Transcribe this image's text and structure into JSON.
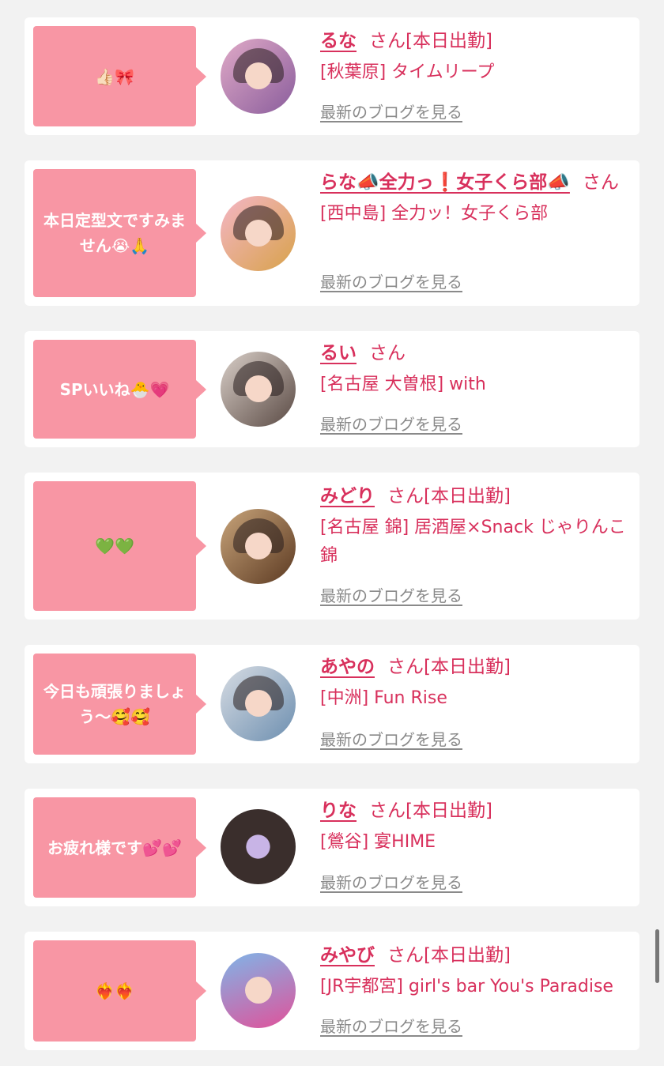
{
  "items": [
    {
      "message": "👍🏻🎀",
      "name": "るな",
      "suffix": "さん[本日出勤]",
      "shop": "[秋葉原] タイムリープ",
      "blog": "最新のブログを見る",
      "avatar_colors": [
        "#e0aac7",
        "#8a5d9c"
      ]
    },
    {
      "message": "本日定型文ですみません😭🙏",
      "name": "らな📣全力っ❗️女子くら部📣",
      "suffix": "さん",
      "shop": "[西中島] 全力ッ！女子くら部",
      "blog": "最新のブログを見る",
      "avatar_colors": [
        "#f4b6c6",
        "#d8a24a"
      ]
    },
    {
      "message": "SPいいね🐣💗",
      "name": "るい",
      "suffix": "さん",
      "shop": "[名古屋 大曽根] with",
      "blog": "最新のブログを見る",
      "avatar_colors": [
        "#d9cfc8",
        "#5a4a44"
      ]
    },
    {
      "message": "💚💚",
      "name": "みどり",
      "suffix": "さん[本日出勤]",
      "shop": "[名古屋 錦] 居酒屋×Snack じゃりんこ錦",
      "blog": "最新のブログを見る",
      "avatar_colors": [
        "#c8a47a",
        "#5c3a22"
      ]
    },
    {
      "message": "今日も頑張りましょう〜🥰🥰",
      "name": "あやの",
      "suffix": "さん[本日出勤]",
      "shop": "[中洲] Fun Rise",
      "blog": "最新のブログを見る",
      "avatar_colors": [
        "#d7dce3",
        "#6d8fb0"
      ]
    },
    {
      "message": "お疲れ様です💕💕",
      "name": "りな",
      "suffix": "さん[本日出勤]",
      "shop": "[鶯谷] 宴HIME",
      "blog": "最新のブログを見る",
      "avatar_colors": [
        "#3a2e2c",
        "#c8b4e6"
      ]
    },
    {
      "message": "❤️‍🔥❤️‍🔥",
      "name": "みやび",
      "suffix": "さん[本日出勤]",
      "shop": "[JR宇都宮] girl's bar You's Paradise",
      "blog": "最新のブログを見る",
      "avatar_colors": [
        "#7fb5e8",
        "#e0529a"
      ]
    }
  ]
}
